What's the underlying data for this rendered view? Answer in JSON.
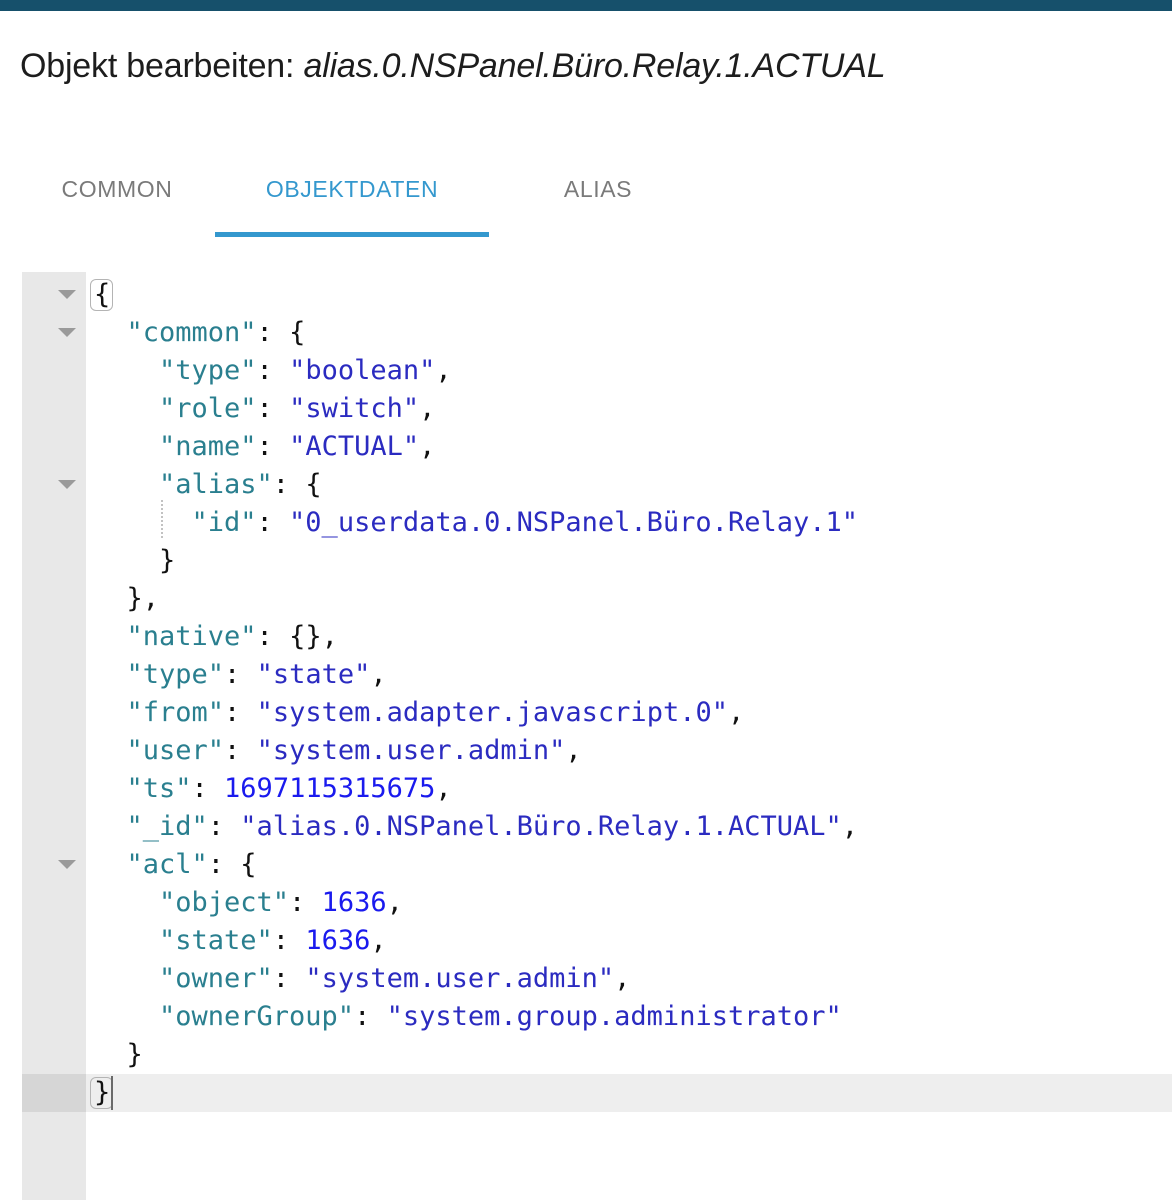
{
  "window": {
    "accent_bar_color": "#16506b"
  },
  "header": {
    "title_static": "Objekt bearbeiten: ",
    "title_object": "alias.0.NSPanel.Büro.Relay.1.ACTUAL"
  },
  "tabs": {
    "active_index": 1,
    "active_color": "#3498ce",
    "inactive_color": "#7a7a7a",
    "items": [
      {
        "label": "COMMON"
      },
      {
        "label": "OBJEKTDATEN"
      },
      {
        "label": "ALIAS"
      }
    ]
  },
  "editor": {
    "colors": {
      "key": "#2a7f8f",
      "string": "#2b2bc0",
      "number": "#1a1aee",
      "punctuation": "#111111",
      "gutter": "#e8e8e8",
      "active_line": "#eeeeee"
    },
    "lines": [
      {
        "indent": 0,
        "tokens": [
          {
            "t": "brace",
            "v": "{"
          }
        ]
      },
      {
        "indent": 1,
        "tokens": [
          {
            "t": "key",
            "v": "\"common\""
          },
          {
            "t": "punc",
            "v": ": "
          },
          {
            "t": "brace",
            "v": "{"
          }
        ]
      },
      {
        "indent": 2,
        "tokens": [
          {
            "t": "key",
            "v": "\"type\""
          },
          {
            "t": "punc",
            "v": ": "
          },
          {
            "t": "str",
            "v": "\"boolean\""
          },
          {
            "t": "punc",
            "v": ","
          }
        ]
      },
      {
        "indent": 2,
        "tokens": [
          {
            "t": "key",
            "v": "\"role\""
          },
          {
            "t": "punc",
            "v": ": "
          },
          {
            "t": "str",
            "v": "\"switch\""
          },
          {
            "t": "punc",
            "v": ","
          }
        ]
      },
      {
        "indent": 2,
        "tokens": [
          {
            "t": "key",
            "v": "\"name\""
          },
          {
            "t": "punc",
            "v": ": "
          },
          {
            "t": "str",
            "v": "\"ACTUAL\""
          },
          {
            "t": "punc",
            "v": ","
          }
        ]
      },
      {
        "indent": 2,
        "tokens": [
          {
            "t": "key",
            "v": "\"alias\""
          },
          {
            "t": "punc",
            "v": ": "
          },
          {
            "t": "brace",
            "v": "{"
          }
        ]
      },
      {
        "indent": 3,
        "tokens": [
          {
            "t": "key",
            "v": "\"id\""
          },
          {
            "t": "punc",
            "v": ": "
          },
          {
            "t": "str",
            "v": "\"0_userdata.0.NSPanel.Büro.Relay.1\""
          }
        ]
      },
      {
        "indent": 2,
        "tokens": [
          {
            "t": "brace",
            "v": "}"
          }
        ]
      },
      {
        "indent": 1,
        "tokens": [
          {
            "t": "brace",
            "v": "}"
          },
          {
            "t": "punc",
            "v": ","
          }
        ]
      },
      {
        "indent": 1,
        "tokens": [
          {
            "t": "key",
            "v": "\"native\""
          },
          {
            "t": "punc",
            "v": ": "
          },
          {
            "t": "brace",
            "v": "{}"
          },
          {
            "t": "punc",
            "v": ","
          }
        ]
      },
      {
        "indent": 1,
        "tokens": [
          {
            "t": "key",
            "v": "\"type\""
          },
          {
            "t": "punc",
            "v": ": "
          },
          {
            "t": "str",
            "v": "\"state\""
          },
          {
            "t": "punc",
            "v": ","
          }
        ]
      },
      {
        "indent": 1,
        "tokens": [
          {
            "t": "key",
            "v": "\"from\""
          },
          {
            "t": "punc",
            "v": ": "
          },
          {
            "t": "str",
            "v": "\"system.adapter.javascript.0\""
          },
          {
            "t": "punc",
            "v": ","
          }
        ]
      },
      {
        "indent": 1,
        "tokens": [
          {
            "t": "key",
            "v": "\"user\""
          },
          {
            "t": "punc",
            "v": ": "
          },
          {
            "t": "str",
            "v": "\"system.user.admin\""
          },
          {
            "t": "punc",
            "v": ","
          }
        ]
      },
      {
        "indent": 1,
        "tokens": [
          {
            "t": "key",
            "v": "\"ts\""
          },
          {
            "t": "punc",
            "v": ": "
          },
          {
            "t": "num",
            "v": "1697115315675"
          },
          {
            "t": "punc",
            "v": ","
          }
        ]
      },
      {
        "indent": 1,
        "tokens": [
          {
            "t": "key",
            "v": "\"_id\""
          },
          {
            "t": "punc",
            "v": ": "
          },
          {
            "t": "str",
            "v": "\"alias.0.NSPanel.Büro.Relay.1.ACTUAL\""
          },
          {
            "t": "punc",
            "v": ","
          }
        ]
      },
      {
        "indent": 1,
        "tokens": [
          {
            "t": "key",
            "v": "\"acl\""
          },
          {
            "t": "punc",
            "v": ": "
          },
          {
            "t": "brace",
            "v": "{"
          }
        ]
      },
      {
        "indent": 2,
        "tokens": [
          {
            "t": "key",
            "v": "\"object\""
          },
          {
            "t": "punc",
            "v": ": "
          },
          {
            "t": "num",
            "v": "1636"
          },
          {
            "t": "punc",
            "v": ","
          }
        ]
      },
      {
        "indent": 2,
        "tokens": [
          {
            "t": "key",
            "v": "\"state\""
          },
          {
            "t": "punc",
            "v": ": "
          },
          {
            "t": "num",
            "v": "1636"
          },
          {
            "t": "punc",
            "v": ","
          }
        ]
      },
      {
        "indent": 2,
        "tokens": [
          {
            "t": "key",
            "v": "\"owner\""
          },
          {
            "t": "punc",
            "v": ": "
          },
          {
            "t": "str",
            "v": "\"system.user.admin\""
          },
          {
            "t": "punc",
            "v": ","
          }
        ]
      },
      {
        "indent": 2,
        "tokens": [
          {
            "t": "key",
            "v": "\"ownerGroup\""
          },
          {
            "t": "punc",
            "v": ": "
          },
          {
            "t": "str",
            "v": "\"system.group.administrator\""
          }
        ]
      },
      {
        "indent": 1,
        "tokens": [
          {
            "t": "brace",
            "v": "}"
          }
        ]
      },
      {
        "indent": 0,
        "tokens": [
          {
            "t": "brace",
            "v": "}"
          }
        ],
        "active": true
      }
    ],
    "fold_arrow_lines": [
      0,
      1,
      5,
      15
    ],
    "bracket_match_lines": [
      0,
      21
    ],
    "indent_guides": [
      {
        "line": 6,
        "indent": 3
      }
    ],
    "caret": {
      "line": 21,
      "col": 1
    }
  }
}
